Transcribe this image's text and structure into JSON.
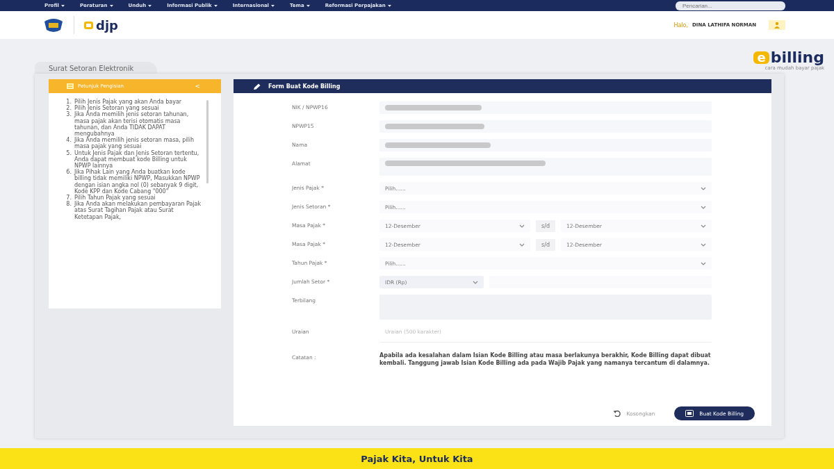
{
  "nav": {
    "items": [
      "Profil",
      "Peraturan",
      "Unduh",
      "Informasi Publik",
      "Internasional",
      "Tema",
      "Reformasi Perpajakan"
    ],
    "search": {
      "placeholder": "Pencarian..."
    }
  },
  "header": {
    "logo_text": "djp",
    "greeting": "Halo,",
    "user": "DINA LATHIFA NORMAN"
  },
  "brand": {
    "letter": "e",
    "name": "billing",
    "tagline": "cara mudah bayar pajak"
  },
  "tab": {
    "label": "Surat Setoran Elektronik"
  },
  "guide": {
    "title": "Petunjuk Pengisian",
    "collapse": "<",
    "steps": [
      {
        "number": "1.",
        "text": "Pilih Jenis Pajak yang akan Anda bayar"
      },
      {
        "number": "2.",
        "text": "Pilih Jenis Setoran yang sesuai"
      },
      {
        "number": "3.",
        "text": "Jika Anda memilih jenis setoran tahunan, masa pajak akan terisi otomatis masa tahunan, dan Anda TIDAK DAPAT mengubahnya"
      },
      {
        "number": "4.",
        "text": "Jika Anda memilih jenis setoran masa, pilih masa pajak yang sesuai"
      },
      {
        "number": "5.",
        "text": "Untuk Jenis Pajak dan Jenis Setoran tertentu, Anda dapat membuat kode Billing untuk NPWP lainnya"
      },
      {
        "number": "6.",
        "text": "Jika Pihak Lain yang Anda buatkan kode billing tidak memiliki NPWP, Masukkan NPWP dengan isian angka nol (0) sebanyak 9 digit, Kode KPP dan Kode Cabang \"000\""
      },
      {
        "number": "7.",
        "text": "Pilih Tahun Pajak yang sesuai"
      },
      {
        "number": "8.",
        "text": "Jika Anda akan melakukan pembayaran Pajak atas Surat Tagihan Pajak atau Surat Ketetapan Pajak,"
      }
    ]
  },
  "form": {
    "title": "Form Buat Kode Billing",
    "rows": [
      {
        "kind": "redacted",
        "label": "NIK / NPWP16"
      },
      {
        "kind": "redacted",
        "label": "NPWP15"
      },
      {
        "kind": "redacted",
        "label": "Nama"
      },
      {
        "kind": "redacted-area",
        "label": "Alamat"
      },
      {
        "kind": "select",
        "label": "Jenis Pajak *",
        "value": "Pilih......"
      },
      {
        "kind": "select",
        "label": "Jenis Setoran *",
        "value": "Pilih......"
      },
      {
        "kind": "range",
        "label": "Masa Pajak *",
        "from": "12-Desember",
        "sep": "s/d",
        "to": "12-Desember"
      },
      {
        "kind": "range",
        "label": "Masa Pajak *",
        "from": "12-Desember",
        "sep": "s/d",
        "to": "12-Desember"
      },
      {
        "kind": "select",
        "label": "Tahun Pajak *",
        "value": "Pilih......"
      },
      {
        "kind": "currency",
        "label": "Jumlah Setor *",
        "value": "IDR (Rp)"
      },
      {
        "kind": "textarea",
        "label": "Terbilang"
      },
      {
        "kind": "textarea-short",
        "label": "Uraian",
        "placeholder": "Uraian (500 karakter)"
      },
      {
        "kind": "note",
        "label": "Catatan :",
        "text": "Apabila ada kesalahan dalam Isian Kode Billing atau masa berlakunya berakhir, Kode Billing dapat dibuat kembali. Tanggung jawab Isian Kode Billing ada pada Wajib Pajak yang namanya tercantum di dalamnya."
      }
    ],
    "reset": "Kosongkan",
    "submit": "Buat Kode Billing"
  },
  "footer": {
    "slogan": "Pajak Kita, Untuk Kita"
  }
}
